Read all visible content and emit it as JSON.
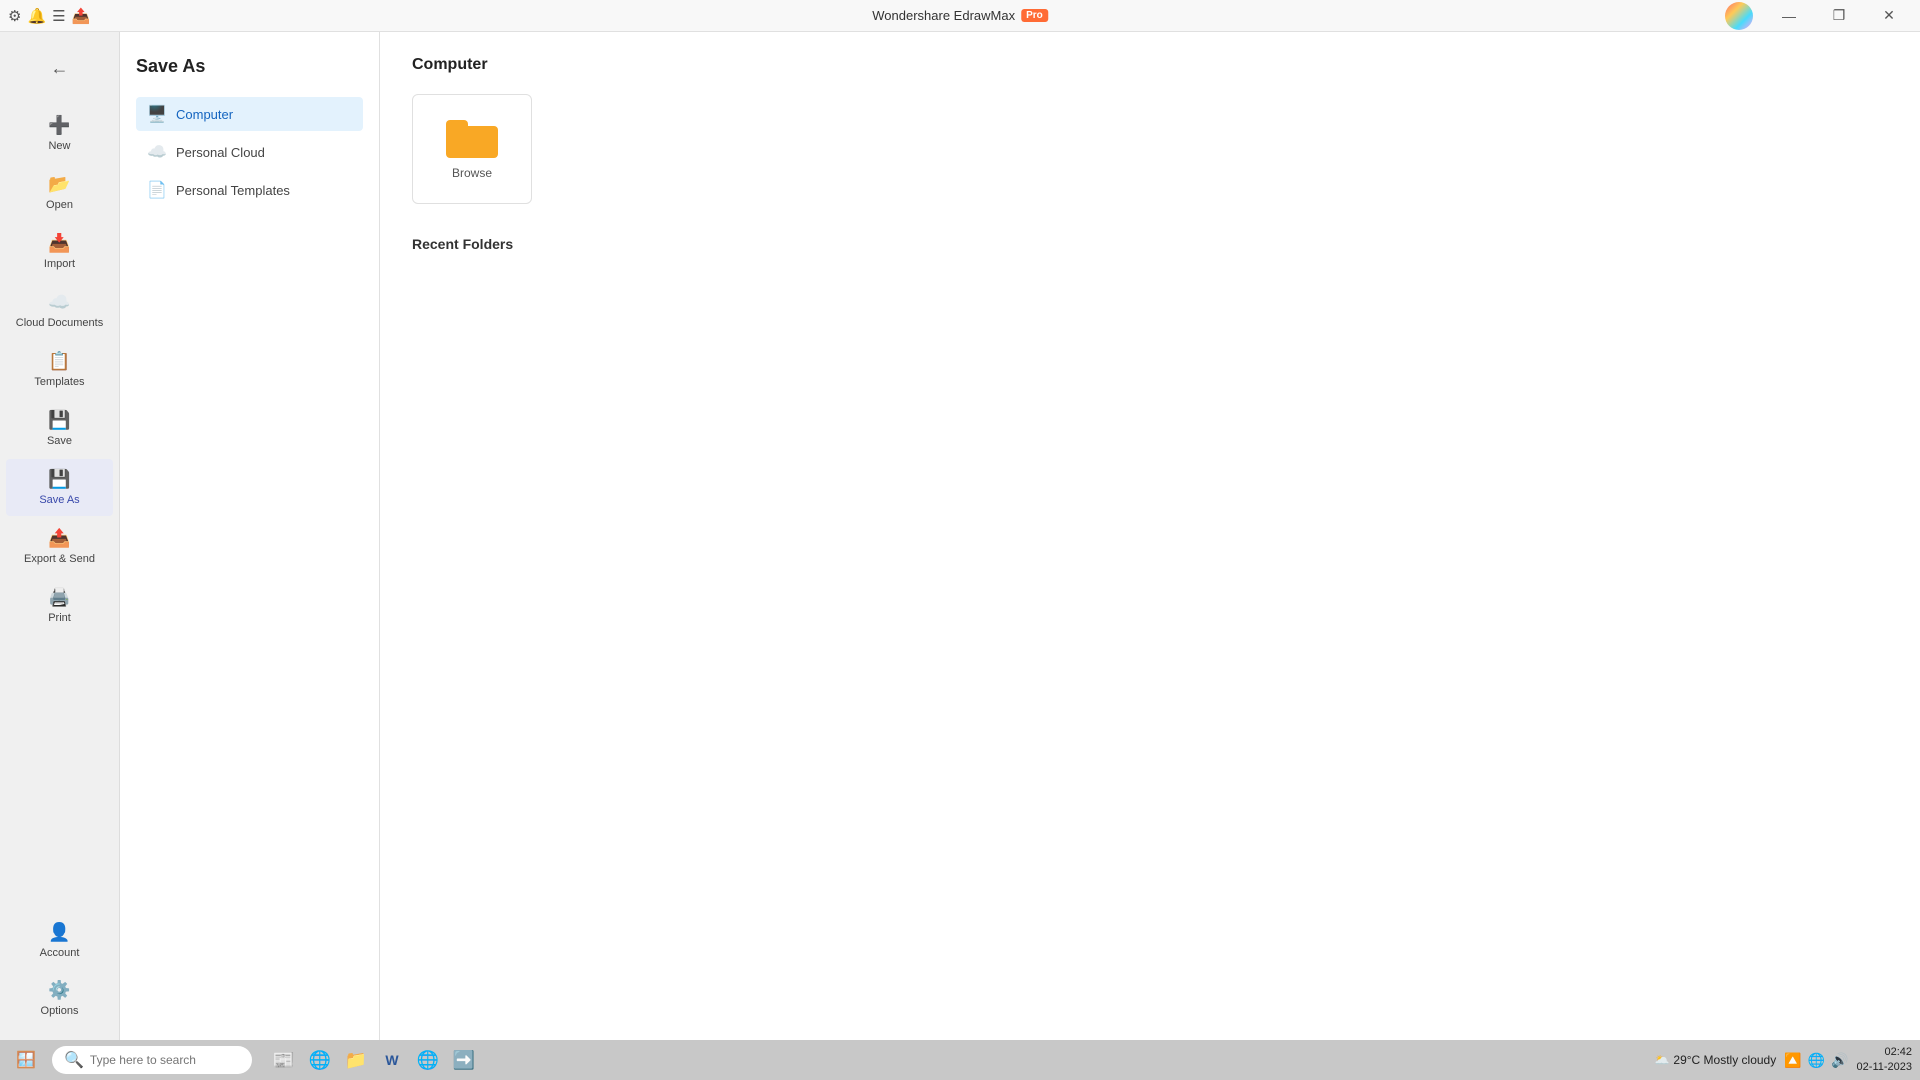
{
  "app": {
    "title": "Wondershare EdrawMax",
    "pro_label": "Pro"
  },
  "titlebar": {
    "minimize": "—",
    "restore": "❐",
    "close": "✕"
  },
  "sidebar_left": {
    "items": [
      {
        "id": "new",
        "label": "New",
        "icon": "➕"
      },
      {
        "id": "open",
        "label": "Open",
        "icon": "📂"
      },
      {
        "id": "import",
        "label": "Import",
        "icon": "📥"
      },
      {
        "id": "cloud",
        "label": "Cloud Documents",
        "icon": "☁️"
      },
      {
        "id": "templates",
        "label": "Templates",
        "icon": "📋"
      },
      {
        "id": "save",
        "label": "Save",
        "icon": "💾"
      },
      {
        "id": "save-as",
        "label": "Save As",
        "icon": "💾"
      },
      {
        "id": "export",
        "label": "Export & Send",
        "icon": "📤"
      },
      {
        "id": "print",
        "label": "Print",
        "icon": "🖨️"
      }
    ],
    "bottom_items": [
      {
        "id": "account",
        "label": "Account",
        "icon": "👤"
      },
      {
        "id": "options",
        "label": "Options",
        "icon": "⚙️"
      }
    ]
  },
  "panel_middle": {
    "title": "Save As",
    "locations": [
      {
        "id": "computer",
        "label": "Computer",
        "active": true
      },
      {
        "id": "personal-cloud",
        "label": "Personal Cloud",
        "active": false
      },
      {
        "id": "personal-templates",
        "label": "Personal Templates",
        "active": false
      }
    ]
  },
  "main": {
    "section_title": "Computer",
    "browse_label": "Browse",
    "recent_folders_title": "Recent Folders"
  },
  "taskbar": {
    "search_placeholder": "Type here to search",
    "weather": "29°C  Mostly cloudy",
    "time": "02:42",
    "date": "02-11-2023",
    "apps": [
      "🪟",
      "🔍",
      "📰",
      "🌐",
      "📁",
      "W",
      "🌐",
      "➡️"
    ]
  }
}
